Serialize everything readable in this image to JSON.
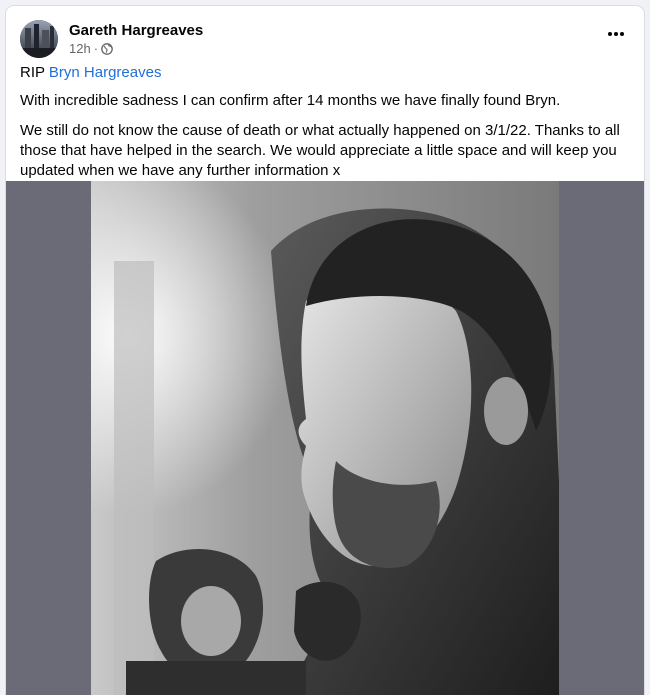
{
  "post": {
    "author": "Gareth Hargreaves",
    "time": "12h",
    "separator": "·",
    "privacy_icon": "globe-icon",
    "more_icon": "more-options-icon",
    "rip_prefix": "RIP ",
    "tagged_name": "Bryn Hargreaves",
    "paragraph_1": "With incredible sadness I can confirm after 14 months we have finally found Bryn.",
    "paragraph_2": "We still do not know the cause of death or what actually happened on 3/1/22. Thanks to all those that have helped in the search. We would appreciate a little space and will keep you updated when we have any further information x"
  },
  "colors": {
    "link": "#216fdb",
    "text": "#050505",
    "muted": "#65676b",
    "photo_side": "#6b6b78"
  }
}
